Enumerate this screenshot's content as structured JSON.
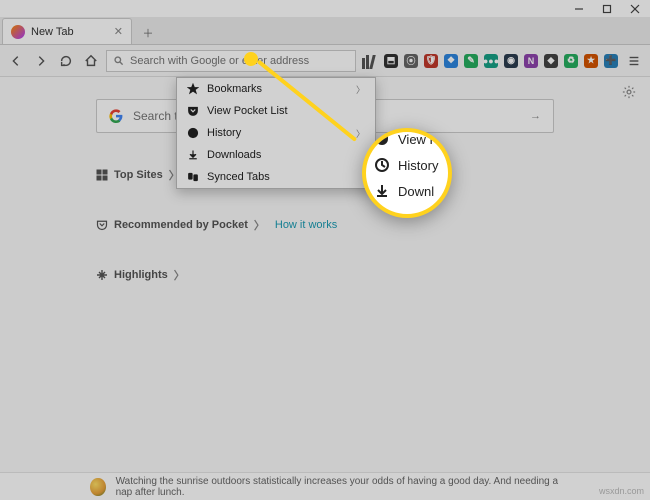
{
  "window": {
    "tab_title": "New Tab"
  },
  "addressbar": {
    "placeholder": "Search with Google or enter address"
  },
  "library_menu": {
    "items": [
      {
        "label": "Bookmarks",
        "icon": "star",
        "has_submenu": true
      },
      {
        "label": "View Pocket List",
        "icon": "pocket",
        "has_submenu": false
      },
      {
        "label": "History",
        "icon": "clock",
        "has_submenu": true
      },
      {
        "label": "Downloads",
        "icon": "download",
        "has_submenu": false
      },
      {
        "label": "Synced Tabs",
        "icon": "sync",
        "has_submenu": false
      }
    ]
  },
  "magnifier": {
    "row0": "View P",
    "row1": "History",
    "row2": "Downl"
  },
  "newtab": {
    "search_placeholder": "Search the Web",
    "topsites_label": "Top Sites",
    "recommended_label": "Recommended by Pocket",
    "how_it_works": "How it works",
    "highlights_label": "Highlights"
  },
  "snippet": {
    "text": "Watching the sunrise outdoors statistically increases your odds of having a good day. And needing a nap after lunch."
  },
  "watermark": "wsxdn.com"
}
